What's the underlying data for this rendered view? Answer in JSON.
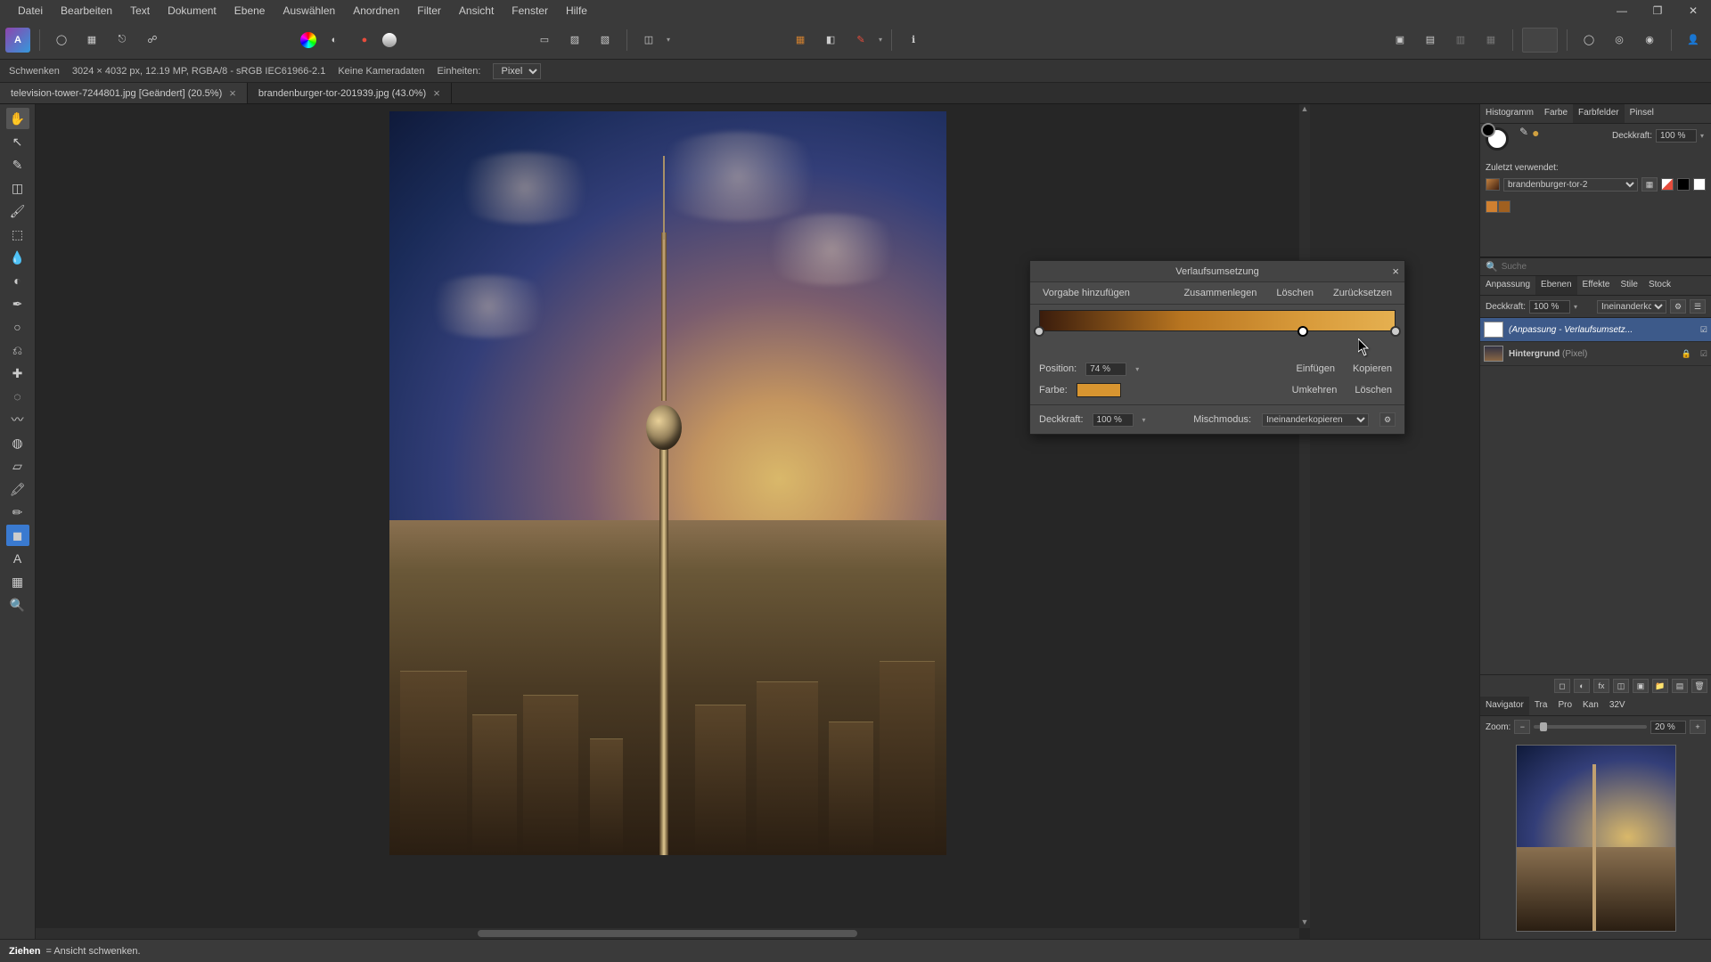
{
  "menus": [
    "Datei",
    "Bearbeiten",
    "Text",
    "Dokument",
    "Ebene",
    "Auswählen",
    "Anordnen",
    "Filter",
    "Ansicht",
    "Fenster",
    "Hilfe"
  ],
  "context": {
    "tool": "Schwenken",
    "docinfo": "3024 × 4032 px, 12.19 MP, RGBA/8 - sRGB IEC61966-2.1",
    "camera": "Keine Kameradaten",
    "units_label": "Einheiten:",
    "units_value": "Pixel"
  },
  "tabs": [
    {
      "label": "television-tower-7244801.jpg [Geändert] (20.5%)",
      "active": true
    },
    {
      "label": "brandenburger-tor-201939.jpg (43.0%)",
      "active": false
    }
  ],
  "dialog": {
    "title": "Verlaufsumsetzung",
    "add_preset": "Vorgabe hinzufügen",
    "merge": "Zusammenlegen",
    "delete": "Löschen",
    "reset": "Zurücksetzen",
    "position_label": "Position:",
    "position_value": "74 %",
    "color_label": "Farbe:",
    "insert": "Einfügen",
    "copy": "Kopieren",
    "invert": "Umkehren",
    "delete2": "Löschen",
    "opacity_label": "Deckkraft:",
    "opacity_value": "100 %",
    "blend_label": "Mischmodus:",
    "blend_value": "Ineinanderkopieren"
  },
  "right": {
    "tabs_top": [
      "Histogramm",
      "Farbe",
      "Farbfelder",
      "Pinsel"
    ],
    "tabs_top_active": 2,
    "opacity_label": "Deckkraft:",
    "opacity_value": "100 %",
    "recent_label": "Zuletzt verwendet:",
    "preset_name": "brandenburger-tor-2",
    "search_placeholder": "Suche",
    "tabs_mid": [
      "Anpassung",
      "Ebenen",
      "Effekte",
      "Stile",
      "Stock"
    ],
    "tabs_mid_active": 1,
    "layer_opacity_label": "Deckkraft:",
    "layer_opacity_value": "100 %",
    "layer_blend": "Ineinanderkc",
    "layers": [
      {
        "name": "(Anpassung - Verlaufsumsetz...",
        "type": "",
        "selected": true
      },
      {
        "name": "Hintergrund",
        "type": "(Pixel)",
        "selected": false
      }
    ],
    "tabs_bot": [
      "Navigator",
      "Tra",
      "Pro",
      "Kan",
      "32V"
    ],
    "tabs_bot_active": 0,
    "zoom_label": "Zoom:",
    "zoom_value": "20 %"
  },
  "status": {
    "action": "Ziehen",
    "desc": "= Ansicht schwenken."
  },
  "window": {
    "min": "—",
    "max": "❐",
    "close": "✕"
  },
  "avatar": "👤"
}
